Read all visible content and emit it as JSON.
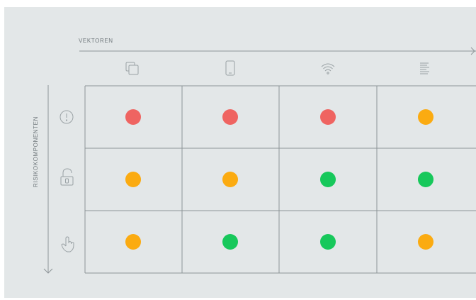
{
  "matrix": {
    "column_axis_label": "VEKTOREN",
    "row_axis_label": "RISIKOKOMPONENTEN",
    "columns": [
      {
        "icon": "copy-windows-icon"
      },
      {
        "icon": "smartphone-icon"
      },
      {
        "icon": "wifi-icon"
      },
      {
        "icon": "text-document-icon"
      }
    ],
    "rows": [
      {
        "icon": "exclamation-circle-icon",
        "cells": [
          "red",
          "red",
          "red",
          "orange"
        ]
      },
      {
        "icon": "padlock-open-icon",
        "cells": [
          "orange",
          "orange",
          "green",
          "green"
        ]
      },
      {
        "icon": "pointing-hand-icon",
        "cells": [
          "orange",
          "green",
          "green",
          "orange"
        ]
      }
    ],
    "status_colors": {
      "red": "#ef6461",
      "orange": "#fbab11",
      "green": "#17c85b"
    },
    "colors": {
      "background": "#e3e7e8",
      "grid_line": "#8d9497",
      "icon_stroke": "#9aa2a5"
    }
  }
}
